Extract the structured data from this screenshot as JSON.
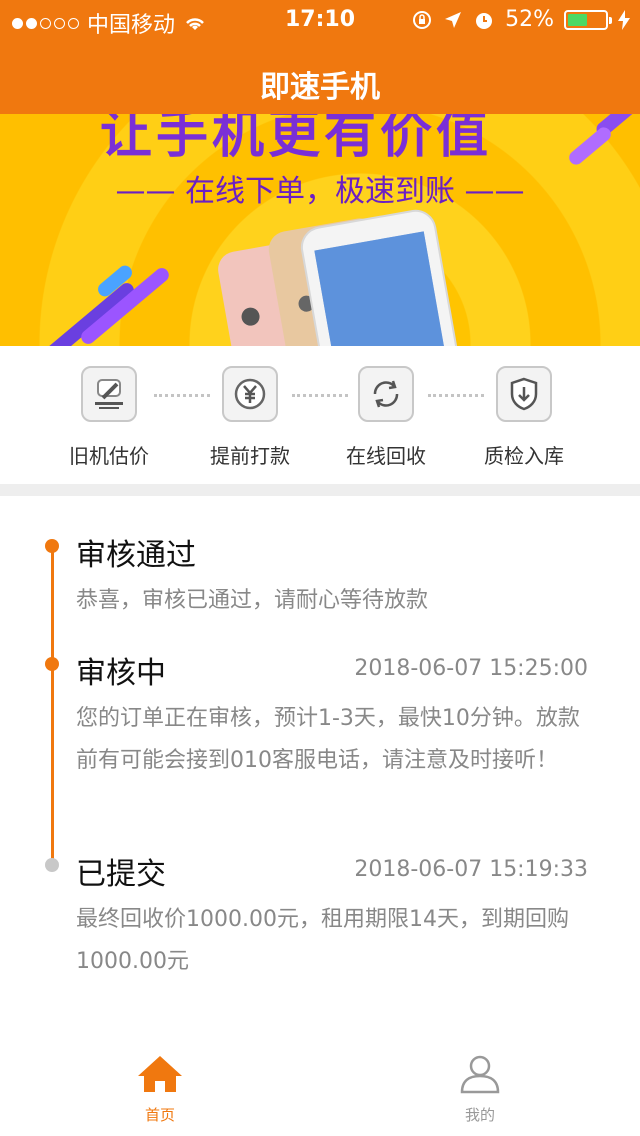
{
  "status_bar": {
    "carrier": "中国移动",
    "time": "17:10",
    "battery": "52%",
    "battery_level": 0.52
  },
  "nav": {
    "title": "即速手机"
  },
  "banner": {
    "headline": "让手机更有价值",
    "subtitle": "—— 在线下单，极速到账 ——"
  },
  "steps": [
    {
      "label": "旧机估价",
      "icon": "gavel-icon"
    },
    {
      "label": "提前打款",
      "icon": "yen-coin-icon"
    },
    {
      "label": "在线回收",
      "icon": "recycle-icon"
    },
    {
      "label": "质检入库",
      "icon": "shield-download-icon"
    }
  ],
  "timeline": [
    {
      "title": "审核通过",
      "time": "",
      "desc": "恭喜，审核已通过，请耐心等待放款"
    },
    {
      "title": "审核中",
      "time": "2018-06-07 15:25:00",
      "desc": "您的订单正在审核，预计1-3天，最快10分钟。放款前有可能会接到010客服电话，请注意及时接听！"
    },
    {
      "title": "已提交",
      "time": "2018-06-07 15:19:33",
      "desc": "最终回收价1000.00元，租用期限14天，到期回购1000.00元"
    }
  ],
  "tabbar": {
    "home_label": "首页",
    "mine_label": "我的"
  },
  "colors": {
    "accent": "#f0780f",
    "inactive": "#999999",
    "banner_yellow": "#ffc400",
    "banner_purple": "#7a2fd6"
  }
}
